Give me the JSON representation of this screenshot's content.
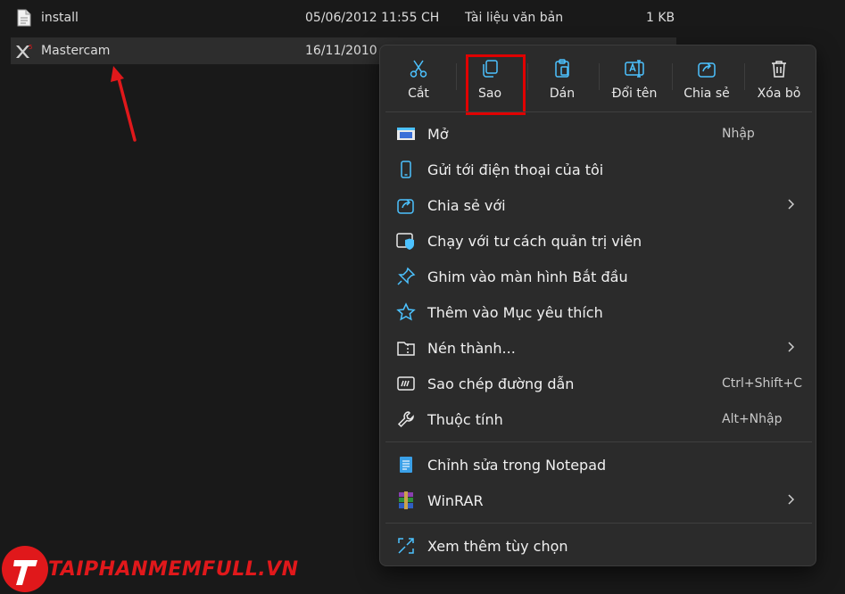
{
  "files": [
    {
      "name": "install",
      "date": "05/06/2012 11:55 CH",
      "type": "Tài liệu văn bản",
      "size": "1 KB",
      "icon": "text-file-icon"
    },
    {
      "name": "Mastercam",
      "date": "16/11/2010 4",
      "type": "",
      "size": "",
      "icon": "mastercam-icon"
    }
  ],
  "toolbar": {
    "cut": "Cắt",
    "copy": "Sao",
    "paste": "Dán",
    "rename": "Đổi tên",
    "share": "Chia sẻ",
    "delete": "Xóa bỏ"
  },
  "menu": {
    "open": {
      "label": "Mở",
      "shortcut": "Nhập"
    },
    "send_phone": {
      "label": "Gửi tới điện thoại của tôi"
    },
    "share_with": {
      "label": "Chia sẻ với"
    },
    "run_admin": {
      "label": "Chạy với tư cách quản trị viên"
    },
    "pin_start": {
      "label": "Ghim vào màn hình Bắt đầu"
    },
    "add_fav": {
      "label": "Thêm vào Mục yêu thích"
    },
    "compress": {
      "label": "Nén thành..."
    },
    "copy_path": {
      "label": "Sao chép đường dẫn",
      "shortcut": "Ctrl+Shift+C"
    },
    "properties": {
      "label": "Thuộc tính",
      "shortcut": "Alt+Nhập"
    },
    "edit_notepad": {
      "label": "Chỉnh sửa trong Notepad"
    },
    "winrar": {
      "label": "WinRAR"
    },
    "more_options": {
      "label": "Xem thêm tùy chọn"
    }
  },
  "watermark": {
    "text": "TAIPHANMEMFULL.VN"
  },
  "colors": {
    "accent": "#4cc2ff",
    "highlight": "#e00000",
    "arrow": "#e0181b"
  }
}
